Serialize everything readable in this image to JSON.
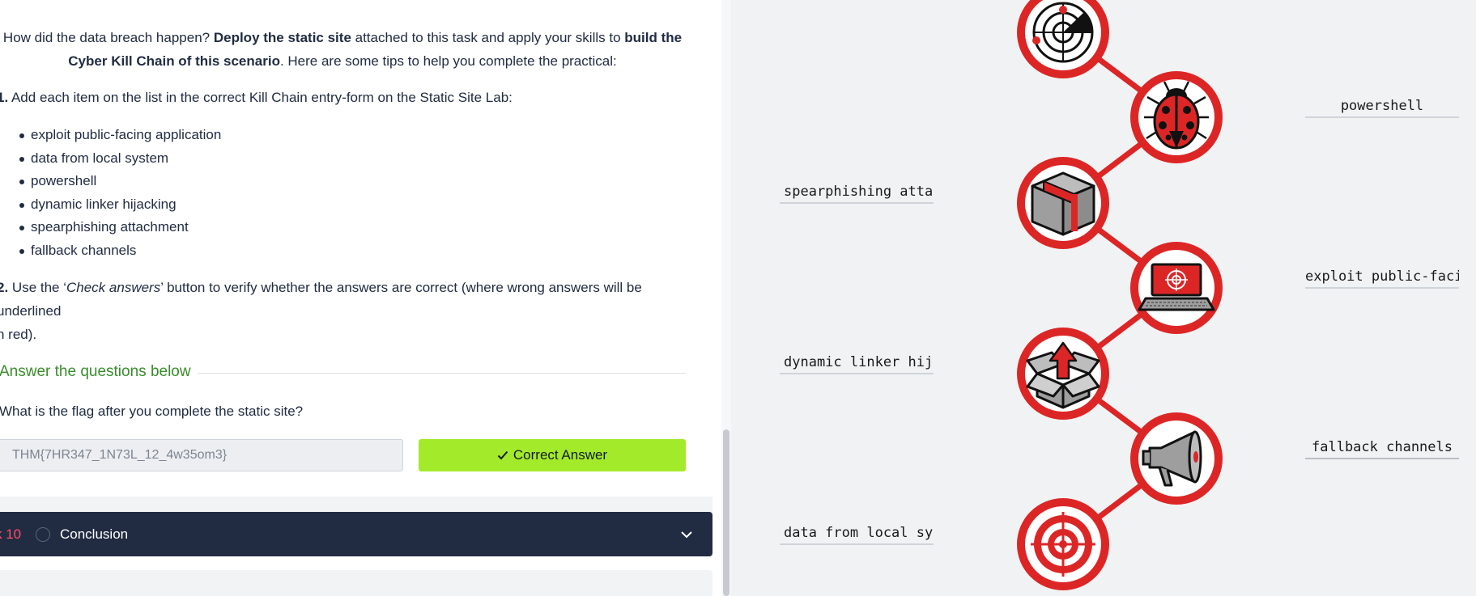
{
  "task": {
    "intro": {
      "part1": "How did the data breach happen? ",
      "bold1": "Deploy the static site",
      "part2": " attached to this task and apply your skills to ",
      "bold2": "build the",
      "bold3": "Cyber Kill Chain of this scenario",
      "part3": ". Here are some tips to help you complete the practical:"
    },
    "step1": {
      "num": "1.",
      "text": " Add each item on the list in the correct Kill Chain entry-form on the Static Site Lab:"
    },
    "tips": [
      "exploit public-facing application",
      "data from local system",
      "powershell",
      "dynamic linker hijacking",
      "spearphishing attachment",
      "fallback channels"
    ],
    "step2": {
      "num": "2.",
      "pre": " Use the ‘",
      "italic": "Check answers",
      "post": "’ button to verify whether the answers are correct (where wrong answers will be underlined",
      "line2": "n red)."
    },
    "answer_section_title": "Answer the questions below",
    "question": "What is the flag after you complete the static site?",
    "answer_value": "THM{7HR347_1N73L_12_4w35om3}",
    "correct_button": "Correct Answer",
    "next_task": {
      "number": "k 10",
      "title": "Conclusion"
    }
  },
  "lab": {
    "slots": [
      {
        "label": "powershell",
        "side": "right"
      },
      {
        "label": "spearphishing attac",
        "side": "left"
      },
      {
        "label": "exploit public-faci",
        "side": "right"
      },
      {
        "label": "dynamic linker hija",
        "side": "left"
      },
      {
        "label": "fallback channels",
        "side": "right"
      },
      {
        "label": "data from local sys",
        "side": "left"
      }
    ],
    "stages": [
      "radar-icon",
      "ladybug-icon",
      "package-icon",
      "laptop-target-icon",
      "open-box-icon",
      "megaphone-icon",
      "target-icon"
    ]
  },
  "colors": {
    "accent_red": "#dc2626",
    "answer_green": "#3a8d2c",
    "correct_button": "#a3ea2a",
    "task_bar": "#212c42",
    "task_number": "#ff4d6a"
  }
}
